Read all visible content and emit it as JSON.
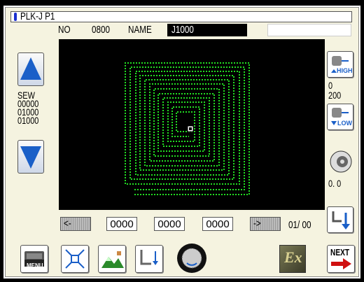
{
  "header": {
    "title": "PLK-J  P1",
    "no_label": "NO",
    "no_value": "0800",
    "name_label": "NAME",
    "name_value": "J1000"
  },
  "left_panel": {
    "lines": [
      "SEW",
      "00000",
      "01000",
      "01000"
    ]
  },
  "right_panel": {
    "high_icon_label": "HIGH",
    "speed_top": "0",
    "speed_bottom": "200",
    "low_icon_label": "LOW",
    "tension_value": "0. 0"
  },
  "bottom_bar": {
    "prev_label": "<-",
    "next_label": "->",
    "fields": [
      "0000",
      "0000",
      "0000"
    ],
    "page": "01/ 00"
  },
  "toolbar": {
    "menu_label": "MENU",
    "next_label": "NEXT",
    "ex_label": "Ex"
  },
  "colors": {
    "stitch": "#22dd22",
    "panel_bg": "#f5f3e0",
    "accent_blue": "#1a5fc8"
  },
  "icons": [
    "up-arrow-icon",
    "down-arrow-icon",
    "thread-high-icon",
    "thread-low-icon",
    "thread-tension-icon",
    "page-return-icon",
    "menu-icon",
    "zoom-icon",
    "image-icon",
    "origin-icon",
    "wheel-icon",
    "ex-icon",
    "next-icon"
  ]
}
